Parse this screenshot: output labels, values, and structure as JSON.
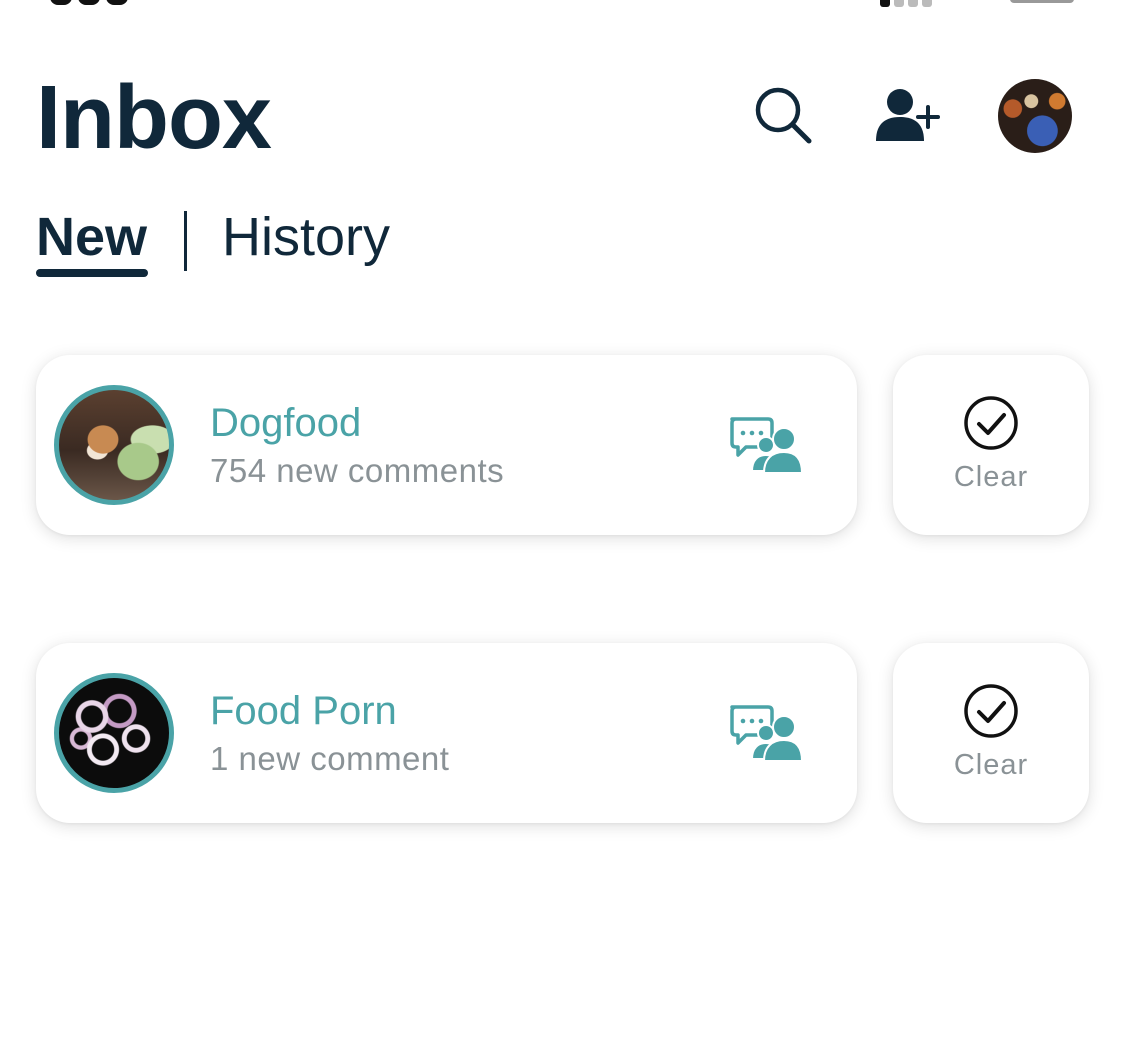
{
  "header": {
    "title": "Inbox",
    "icons": {
      "search": "search-icon",
      "add_user": "add-user-icon",
      "avatar": "profile-avatar"
    }
  },
  "tabs": [
    {
      "label": "New",
      "active": true
    },
    {
      "label": "History",
      "active": false
    }
  ],
  "notifications": [
    {
      "community": "Dogfood",
      "count_text": "754 new comments",
      "icon": "group-comments-icon",
      "clear_label": "Clear"
    },
    {
      "community": "Food Porn",
      "count_text": "1 new comment",
      "icon": "group-comments-icon",
      "clear_label": "Clear"
    }
  ],
  "colors": {
    "title": "#10283a",
    "accent": "#4aa3a7",
    "muted_text": "#8a9296",
    "background": "#ffffff"
  }
}
